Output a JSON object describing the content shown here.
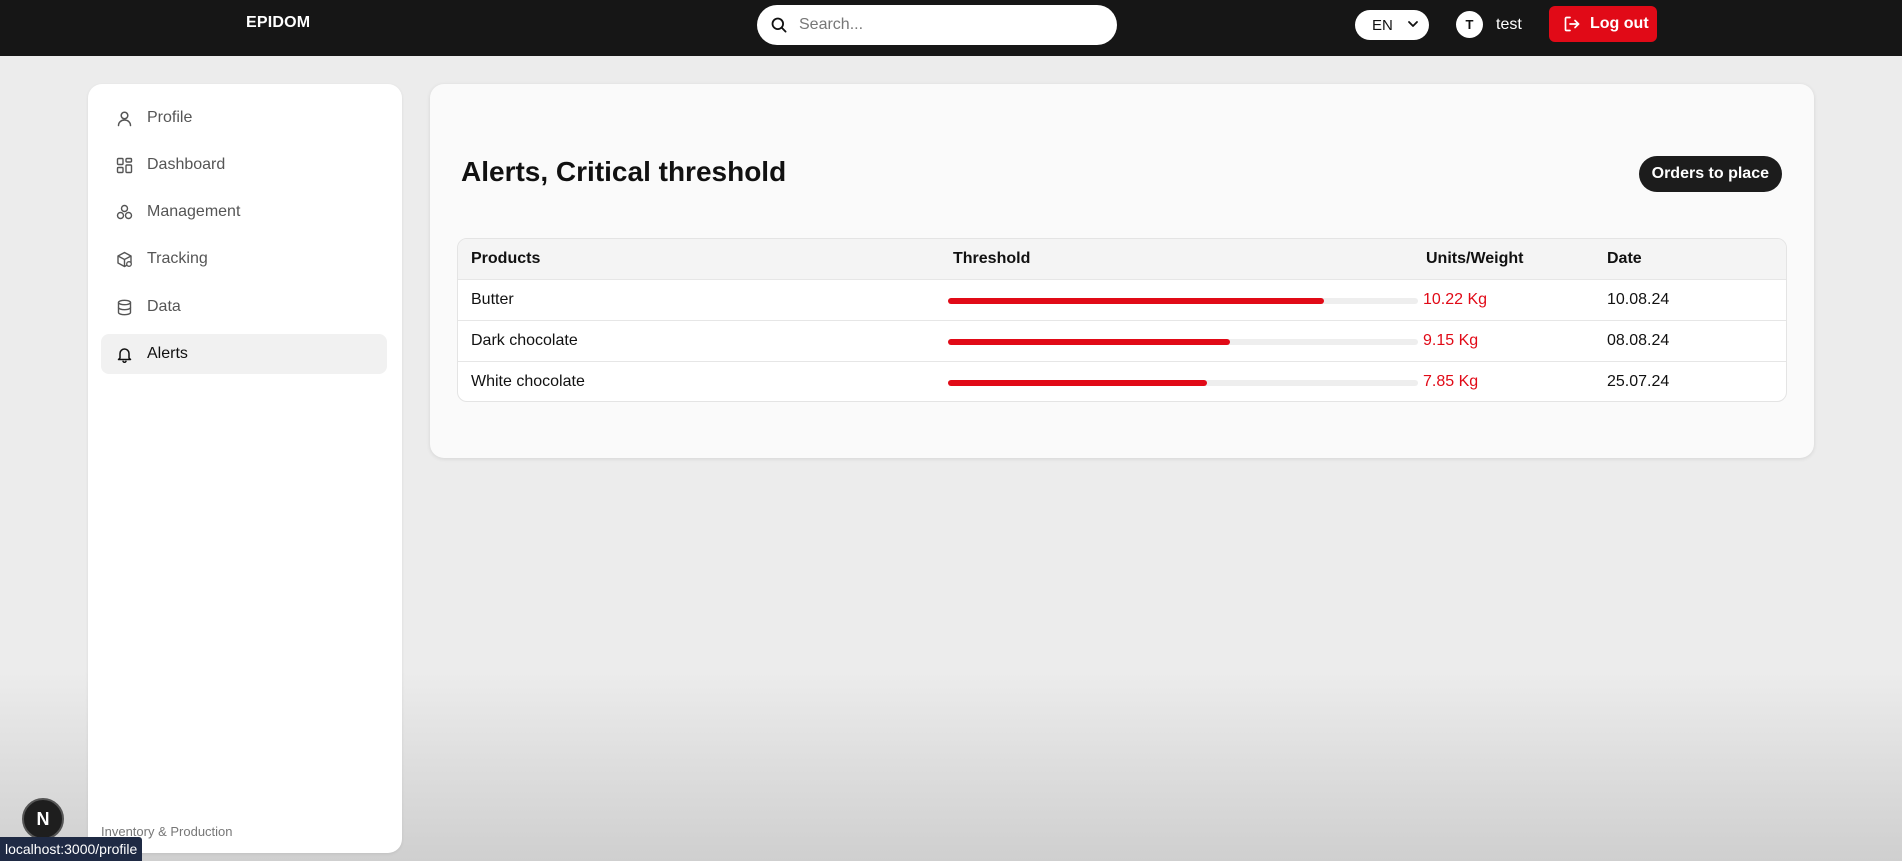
{
  "header": {
    "logo_text": "EPIDOM",
    "search_placeholder": "Search...",
    "language": "EN",
    "user_initial": "T",
    "user_name": "test",
    "logout_label": "Log out"
  },
  "sidebar": {
    "items": [
      {
        "label": "Profile",
        "icon": "user-icon"
      },
      {
        "label": "Dashboard",
        "icon": "dashboard-icon"
      },
      {
        "label": "Management",
        "icon": "management-icon"
      },
      {
        "label": "Tracking",
        "icon": "package-icon"
      },
      {
        "label": "Data",
        "icon": "database-icon"
      },
      {
        "label": "Alerts",
        "icon": "bell-icon",
        "active": true
      }
    ],
    "footer": "Inventory & Production"
  },
  "main": {
    "title": "Alerts, Critical threshold",
    "action_label": "Orders to place",
    "table": {
      "headers": [
        "Products",
        "Threshold",
        "Units/Weight",
        "Date"
      ],
      "rows": [
        {
          "product": "Butter",
          "threshold_fraction": 0.8,
          "weight": "10.22 Kg",
          "date": "10.08.24"
        },
        {
          "product": "Dark chocolate",
          "threshold_fraction": 0.6,
          "weight": "9.15 Kg",
          "date": "08.08.24"
        },
        {
          "product": "White chocolate",
          "threshold_fraction": 0.55,
          "weight": "7.85 Kg",
          "date": "25.07.24"
        }
      ]
    }
  },
  "overlay": {
    "next_badge": "N",
    "status_url": "localhost:3000/profile"
  },
  "colors": {
    "accent_red": "#e10a17",
    "topbar": "#161616"
  }
}
